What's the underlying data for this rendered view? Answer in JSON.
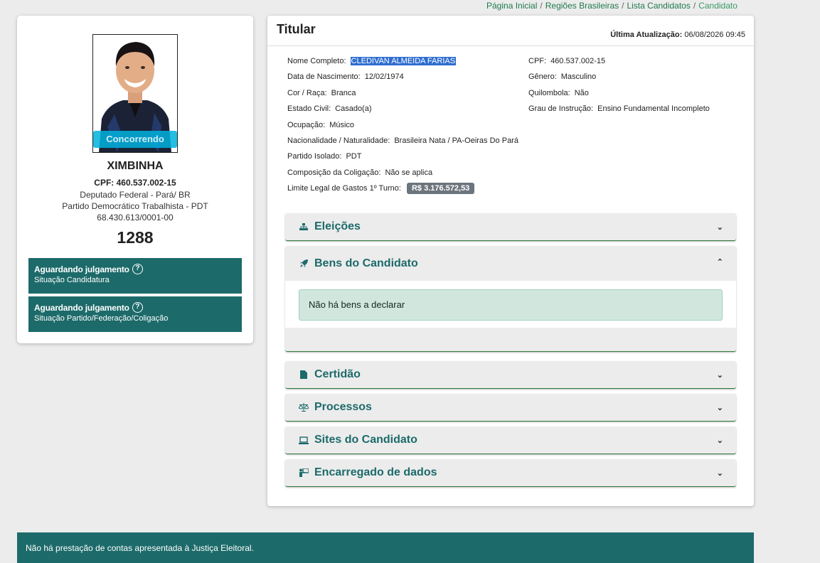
{
  "breadcrumb": {
    "items": [
      "Página Inicial",
      "Regiões Brasileiras",
      "Lista Candidatos"
    ],
    "current": "Candidato",
    "separator": "/"
  },
  "candidate": {
    "badge": "Concorrendo",
    "name": "XIMBINHA",
    "cpf_line": "CPF: 460.537.002-15",
    "office": "Deputado Federal - Pará/ BR",
    "party": "Partido Democrático Trabalhista - PDT",
    "cnpj": "68.430.613/0001-00",
    "number": "1288",
    "status": [
      {
        "title": "Aguardando julgamento",
        "subtitle": "Situação Candidatura"
      },
      {
        "title": "Aguardando julgamento",
        "subtitle": "Situação Partido/Federação/Coligação"
      }
    ]
  },
  "main": {
    "title": "Titular",
    "update_label": "Última Atualização:",
    "update_value": "06/08/2026 09:45",
    "fields": {
      "nome": {
        "label": "Nome Completo:",
        "value": "CLEDIVAN ALMEIDA FARIAS"
      },
      "cpf": {
        "label": "CPF:",
        "value": "460.537.002-15"
      },
      "nascimento": {
        "label": "Data de Nascimento:",
        "value": "12/02/1974"
      },
      "genero": {
        "label": "Gênero:",
        "value": "Masculino"
      },
      "cor": {
        "label": "Cor / Raça:",
        "value": "Branca"
      },
      "quilombola": {
        "label": "Quilombola:",
        "value": "Não"
      },
      "civil": {
        "label": "Estado Civil:",
        "value": "Casado(a)"
      },
      "instrucao": {
        "label": "Grau de Instrução:",
        "value": "Ensino Fundamental Incompleto"
      },
      "ocupacao": {
        "label": "Ocupação:",
        "value": "Músico"
      },
      "nacionalidade": {
        "label": "Nacionalidade / Naturalidade:",
        "value": "Brasileira Nata / PA-Oeiras Do Pará"
      },
      "partido": {
        "label": "Partido Isolado:",
        "value": "PDT"
      },
      "coligacao": {
        "label": "Composição da Coligação:",
        "value": "Não se aplica"
      },
      "limite": {
        "label": "Limite Legal de Gastos 1º Turno:",
        "value": "R$ 3.176.572,53"
      }
    },
    "accordions": [
      {
        "label": "Eleições",
        "icon": "sitemap-icon",
        "expanded": false
      },
      {
        "label": "Bens do Candidato",
        "icon": "rocket-icon",
        "expanded": true,
        "body": "Não há bens a declarar"
      },
      {
        "label": "Certidão",
        "icon": "file-icon",
        "expanded": false
      },
      {
        "label": "Processos",
        "icon": "balance-scale-icon",
        "expanded": false
      },
      {
        "label": "Sites do Candidato",
        "icon": "laptop-icon",
        "expanded": false
      },
      {
        "label": "Encarregado de dados",
        "icon": "person-chalkboard-icon",
        "expanded": false
      }
    ]
  },
  "footer": {
    "message": "Não há prestação de contas apresentada à Justiça Eleitoral."
  },
  "colors": {
    "accent": "#1d6a6a",
    "breadcrumb_link": "#1f7a4d",
    "badge": "#00b2de",
    "money_badge": "#6c757d",
    "alert_bg": "#d1e7dd"
  }
}
